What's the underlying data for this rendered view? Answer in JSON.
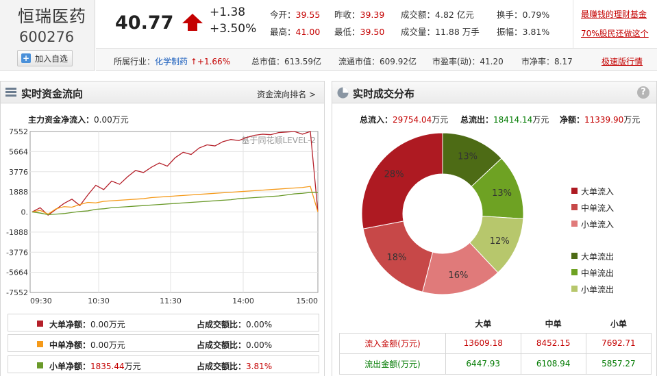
{
  "stock": {
    "name": "恒瑞医药",
    "code": "600276",
    "add_button": "加入自选"
  },
  "quote": {
    "price": "40.77",
    "change": "+1.38",
    "change_pct": "+3.50%",
    "open_label": "今开：",
    "open": "39.55",
    "prev_close_label": "昨收：",
    "prev_close": "39.39",
    "amount_label": "成交额：",
    "amount": "4.82 亿元",
    "turnover_label": "换手：",
    "turnover": "0.79%",
    "high_label": "最高：",
    "high": "41.00",
    "low_label": "最低：",
    "low": "39.50",
    "volume_label": "成交量：",
    "volume": "11.88 万手",
    "amplitude_label": "振幅：",
    "amplitude": "3.81%"
  },
  "ads": {
    "line1": "最赚钱的理财基金",
    "line2": "70%股民还做这个"
  },
  "info_bar": {
    "industry_label": "所属行业：",
    "industry": "化学制药",
    "industry_change": "↑+1.66%",
    "market_cap_label": "总市值：",
    "market_cap": "613.59亿",
    "float_cap_label": "流通市值：",
    "float_cap": "609.92亿",
    "pe_label": "市盈率(动)：",
    "pe": "41.20",
    "pb_label": "市净率：",
    "pb": "8.17",
    "fast_link": "极速版行情"
  },
  "left_panel": {
    "title": "实时资金流向",
    "rank_link": "资金流向排名 >",
    "net_label": "主力资金净流入：",
    "net_value": "0.00万元",
    "watermark": "基于同花顺LEVEL-2",
    "legend": [
      {
        "label": "大单净额：",
        "value": "0.00",
        "unit": "万元",
        "ratio_label": "占成交额比：",
        "ratio": "0.00%",
        "color": "#b5202a",
        "value_color": "#222"
      },
      {
        "label": "中单净额：",
        "value": "0.00",
        "unit": "万元",
        "ratio_label": "占成交额比：",
        "ratio": "0.00%",
        "color": "#f59a1a",
        "value_color": "#222"
      },
      {
        "label": "小单净额：",
        "value": "1835.44",
        "unit": "万元",
        "ratio_label": "占成交额比：",
        "ratio": "3.81%",
        "color": "#6a9a2a",
        "value_color": "#c40000"
      }
    ]
  },
  "right_panel": {
    "title": "实时成交分布",
    "help": "?",
    "total_in_label": "总流入：",
    "total_in": "29754.04",
    "total_in_unit": "万元",
    "total_out_label": "总流出：",
    "total_out": "18414.14",
    "total_out_unit": "万元",
    "net_label": "净额：",
    "net": "11339.90",
    "net_unit": "万元",
    "pie_legend": [
      "大单流入",
      "中单流入",
      "小单流入",
      "大单流出",
      "中单流出",
      "小单流出"
    ],
    "table": {
      "headers": [
        "",
        "大单",
        "中单",
        "小单"
      ],
      "inflow": [
        "流入金额(万元)",
        "13609.18",
        "8452.15",
        "7692.71"
      ],
      "outflow": [
        "流出金额(万元)",
        "6447.93",
        "6108.94",
        "5857.27"
      ]
    }
  },
  "chart_data": [
    {
      "type": "line",
      "title": "实时资金流向",
      "x_ticks": [
        "09:30",
        "10:30",
        "11:30",
        "14:00",
        "15:00"
      ],
      "y_ticks": [
        "7552",
        "5664",
        "3776",
        "1888",
        "0.",
        "-1888",
        "-3776",
        "-5664",
        "-7552"
      ],
      "ylim": [
        -7552,
        7552
      ],
      "grid": true,
      "series": [
        {
          "name": "大单净额",
          "color": "#b5202a",
          "values": [
            0,
            400,
            -300,
            250,
            800,
            1200,
            600,
            1600,
            2500,
            2100,
            2900,
            2600,
            3300,
            3900,
            3700,
            4200,
            4600,
            4300,
            5100,
            5600,
            5400,
            6000,
            6300,
            6200,
            6600,
            6800,
            6700,
            7000,
            7200,
            7300,
            7250,
            7450,
            7500,
            7550,
            7300,
            7552,
            0
          ]
        },
        {
          "name": "中单净额",
          "color": "#f59a1a",
          "values": [
            0,
            150,
            -200,
            300,
            500,
            450,
            700,
            900,
            850,
            1000,
            1050,
            1100,
            1150,
            1200,
            1250,
            1350,
            1400,
            1450,
            1500,
            1550,
            1600,
            1650,
            1700,
            1750,
            1800,
            1850,
            1900,
            1950,
            2000,
            2050,
            2100,
            2150,
            2200,
            2250,
            2300,
            2400,
            0
          ]
        },
        {
          "name": "小单净额",
          "color": "#6a9a2a",
          "values": [
            0,
            -100,
            -250,
            -200,
            -150,
            -50,
            50,
            100,
            250,
            300,
            400,
            450,
            500,
            550,
            600,
            650,
            700,
            750,
            800,
            850,
            900,
            950,
            1000,
            1050,
            1100,
            1150,
            1250,
            1300,
            1350,
            1400,
            1450,
            1500,
            1600,
            1700,
            1750,
            1835,
            1835
          ]
        }
      ]
    },
    {
      "type": "pie",
      "title": "实时成交分布",
      "slices": [
        {
          "label": "大单流出",
          "value": 13,
          "color": "#4d6b15"
        },
        {
          "label": "中单流出",
          "value": 13,
          "color": "#6ea223"
        },
        {
          "label": "小单流出",
          "value": 12,
          "color": "#b7c76c"
        },
        {
          "label": "小单流入",
          "value": 16,
          "color": "#e07a7a"
        },
        {
          "label": "中单流入",
          "value": 18,
          "color": "#c74848"
        },
        {
          "label": "大单流入",
          "value": 28,
          "color": "#ae1a22"
        }
      ]
    }
  ]
}
